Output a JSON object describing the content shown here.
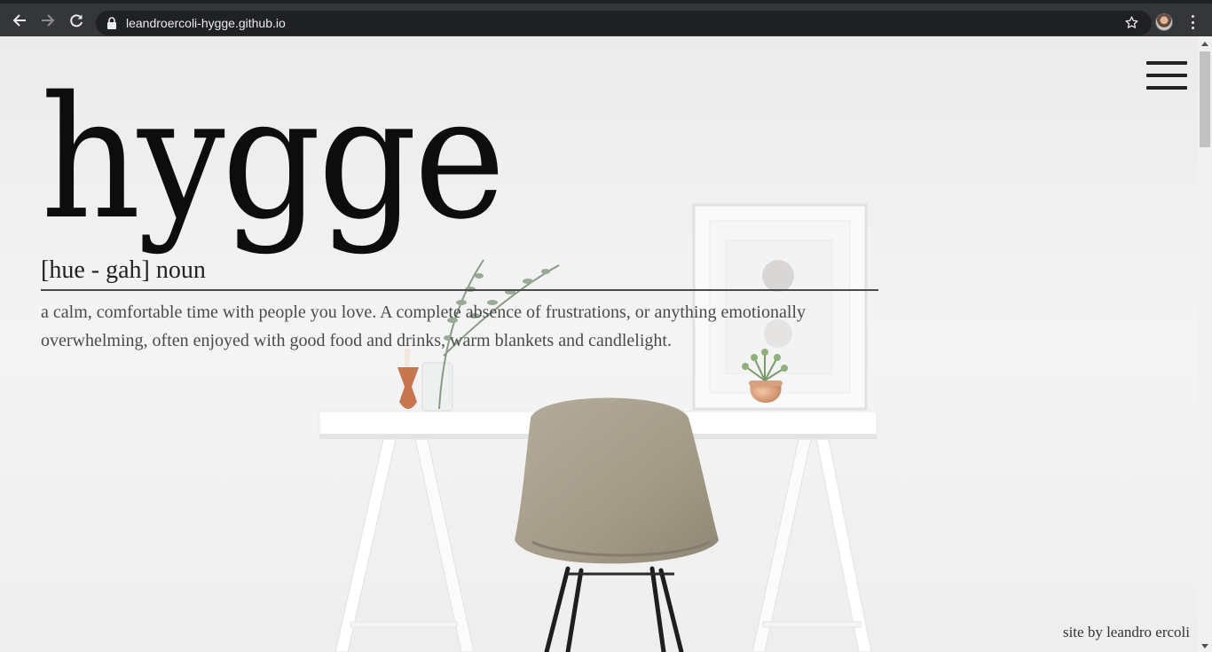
{
  "browser": {
    "url": "leandroercoli-hygge.github.io",
    "icons": [
      "back-arrow-icon",
      "forward-arrow-icon",
      "reload-icon",
      "lock-icon",
      "star-icon",
      "profile-avatar",
      "kebab-menu-icon"
    ]
  },
  "hero": {
    "title": "hygge",
    "pronunciation": "[hue - gah] noun",
    "definition": "a calm, comfortable time with people you love. A complete absence of frustrations, or anything emotionally overwhelming, often enjoyed with good food and drinks, warm blankets and candlelight."
  },
  "footer": {
    "credit": "site by leandro ercoli"
  },
  "colors": {
    "text_dark": "#0d0d0d",
    "text_body": "#4a4a4a",
    "chrome_bg": "#35363a",
    "omnibox_bg": "#202124",
    "chair": "#a79e8c"
  }
}
